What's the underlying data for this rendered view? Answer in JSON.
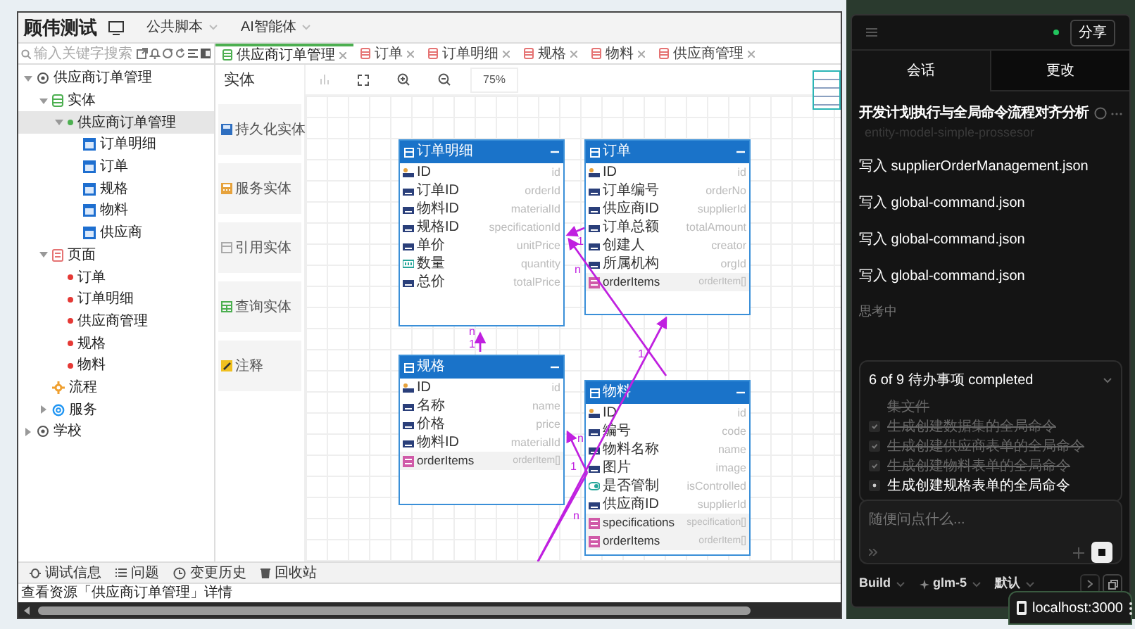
{
  "app": {
    "title": "顾伟测试",
    "menus": [
      {
        "label": "公共脚本"
      },
      {
        "label": "AI智能体"
      }
    ]
  },
  "search": {
    "placeholder": "输入关键字搜索"
  },
  "tree": [
    {
      "label": "供应商订单管理",
      "kind": "module",
      "expanded": true,
      "selected": false,
      "children": [
        {
          "label": "实体",
          "kind": "entities",
          "expanded": true,
          "selected": false,
          "children": [
            {
              "label": "供应商订单管理",
              "kind": "group",
              "expanded": true,
              "selected": true,
              "children": [
                {
                  "label": "订单明细",
                  "kind": "entity",
                  "selected": false
                },
                {
                  "label": "订单",
                  "kind": "entity",
                  "selected": false
                },
                {
                  "label": "规格",
                  "kind": "entity",
                  "selected": false
                },
                {
                  "label": "物料",
                  "kind": "entity",
                  "selected": false
                },
                {
                  "label": "供应商",
                  "kind": "entity",
                  "selected": false
                }
              ]
            }
          ]
        },
        {
          "label": "页面",
          "kind": "pages",
          "expanded": true,
          "selected": false,
          "children": [
            {
              "label": "订单",
              "kind": "page",
              "selected": false
            },
            {
              "label": "订单明细",
              "kind": "page",
              "selected": false
            },
            {
              "label": "供应商管理",
              "kind": "page",
              "selected": false
            },
            {
              "label": "规格",
              "kind": "page",
              "selected": false
            },
            {
              "label": "物料",
              "kind": "page",
              "selected": false
            }
          ]
        },
        {
          "label": "流程",
          "kind": "flow",
          "selected": false
        },
        {
          "label": "服务",
          "kind": "service",
          "expanded": false,
          "selected": false
        }
      ]
    },
    {
      "label": "学校",
      "kind": "module",
      "expanded": false,
      "selected": false
    }
  ],
  "tabs": [
    {
      "label": "供应商订单管理",
      "kind": "entities",
      "selected": true
    },
    {
      "label": "订单",
      "kind": "page",
      "selected": false
    },
    {
      "label": "订单明细",
      "kind": "page",
      "selected": false
    },
    {
      "label": "规格",
      "kind": "page",
      "selected": false
    },
    {
      "label": "物料",
      "kind": "page",
      "selected": false
    },
    {
      "label": "供应商管理",
      "kind": "page",
      "selected": false
    }
  ],
  "palette": {
    "title": "实体",
    "items": [
      {
        "label": "持久化实体",
        "kind": "persistent"
      },
      {
        "label": "服务实体",
        "kind": "service"
      },
      {
        "label": "引用实体",
        "kind": "reference"
      },
      {
        "label": "查询实体",
        "kind": "query"
      },
      {
        "label": "注释",
        "kind": "note"
      }
    ]
  },
  "toolbar": {
    "zoom": "75%"
  },
  "entities": [
    {
      "title": "订单明细",
      "fields": [
        {
          "label": "ID",
          "name": "id",
          "kind": "key"
        },
        {
          "label": "订单ID",
          "name": "orderId",
          "kind": "text"
        },
        {
          "label": "物料ID",
          "name": "materialId",
          "kind": "text"
        },
        {
          "label": "规格ID",
          "name": "specificationId",
          "kind": "text"
        },
        {
          "label": "单价",
          "name": "unitPrice",
          "kind": "text"
        },
        {
          "label": "数量",
          "name": "quantity",
          "kind": "number"
        },
        {
          "label": "总价",
          "name": "totalPrice",
          "kind": "text"
        }
      ]
    },
    {
      "title": "订单",
      "fields": [
        {
          "label": "ID",
          "name": "id",
          "kind": "key"
        },
        {
          "label": "订单编号",
          "name": "orderNo",
          "kind": "text"
        },
        {
          "label": "供应商ID",
          "name": "supplierId",
          "kind": "text"
        },
        {
          "label": "订单总额",
          "name": "totalAmount",
          "kind": "text"
        },
        {
          "label": "创建人",
          "name": "creator",
          "kind": "text"
        },
        {
          "label": "所属机构",
          "name": "orgId",
          "kind": "text"
        },
        {
          "label": "orderItems",
          "name": "orderItem[]",
          "kind": "relation"
        }
      ]
    },
    {
      "title": "规格",
      "fields": [
        {
          "label": "ID",
          "name": "id",
          "kind": "key"
        },
        {
          "label": "名称",
          "name": "name",
          "kind": "text"
        },
        {
          "label": "价格",
          "name": "price",
          "kind": "text"
        },
        {
          "label": "物料ID",
          "name": "materialId",
          "kind": "text"
        },
        {
          "label": "orderItems",
          "name": "orderItem[]",
          "kind": "relation"
        }
      ]
    },
    {
      "title": "物料",
      "fields": [
        {
          "label": "ID",
          "name": "id",
          "kind": "key"
        },
        {
          "label": "编号",
          "name": "code",
          "kind": "text"
        },
        {
          "label": "物料名称",
          "name": "name",
          "kind": "text"
        },
        {
          "label": "图片",
          "name": "image",
          "kind": "text"
        },
        {
          "label": "是否管制",
          "name": "isControlled",
          "kind": "boolean"
        },
        {
          "label": "供应商ID",
          "name": "supplierId",
          "kind": "text"
        },
        {
          "label": "specifications",
          "name": "specification[]",
          "kind": "relation"
        },
        {
          "label": "orderItems",
          "name": "orderItem[]",
          "kind": "relation"
        }
      ]
    }
  ],
  "relations": [
    {
      "labels": [
        "1"
      ]
    },
    {
      "labels": [
        "n"
      ]
    },
    {
      "labels": [
        "n",
        "1"
      ]
    },
    {
      "labels": [
        "1"
      ]
    },
    {
      "labels": [
        "n",
        "1"
      ]
    },
    {
      "labels": [
        "n"
      ]
    }
  ],
  "bottom_tabs": [
    {
      "label": "调试信息",
      "kind": "debug"
    },
    {
      "label": "问题",
      "kind": "issues"
    },
    {
      "label": "变更历史",
      "kind": "history"
    },
    {
      "label": "回收站",
      "kind": "trash"
    }
  ],
  "status_bar": "查看资源「供应商订单管理」详情",
  "assistant": {
    "share": "分享",
    "online": true,
    "tabs": [
      {
        "label": "会话",
        "selected": true
      },
      {
        "label": "更改",
        "selected": false
      }
    ],
    "task": {
      "title": "开发计划执行与全局命令流程对齐分析",
      "subtitle": "entity-model-simple-prossesor"
    },
    "steps": [
      {
        "action": "写入",
        "file": "supplierOrderManagement.json"
      },
      {
        "action": "写入",
        "file": "global-command.json"
      },
      {
        "action": "写入",
        "file": "global-command.json"
      },
      {
        "action": "写入",
        "file": "global-command.json"
      }
    ],
    "thinking": "思考中",
    "todos": {
      "summary": "6 of 9 待办事项 completed",
      "items": [
        {
          "text": "集文件",
          "done": true,
          "continued": true
        },
        {
          "text": "生成创建数据集的全局命令",
          "done": true
        },
        {
          "text": "生成创建供应商表单的全局命令",
          "done": true
        },
        {
          "text": "生成创建物料表单的全局命令",
          "done": true
        },
        {
          "text": "生成创建规格表单的全局命令",
          "done": false
        }
      ]
    },
    "input": {
      "placeholder": "随便问点什么..."
    },
    "footer": [
      {
        "label": "Build",
        "kind": "mode"
      },
      {
        "label": "glm-5",
        "kind": "model"
      },
      {
        "label": "默认",
        "kind": "variant"
      }
    ]
  },
  "browser_tab": {
    "label": "localhost:3000"
  }
}
